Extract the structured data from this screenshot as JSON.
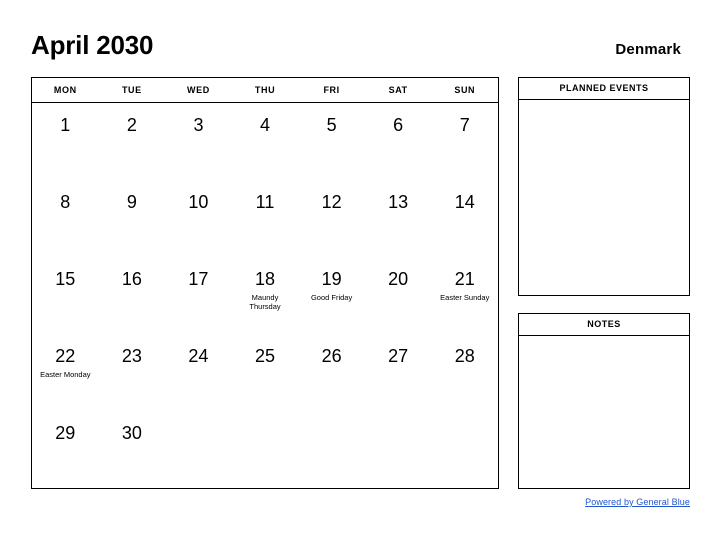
{
  "header": {
    "title": "April 2030",
    "region": "Denmark"
  },
  "calendar": {
    "weekdays": [
      "MON",
      "TUE",
      "WED",
      "THU",
      "FRI",
      "SAT",
      "SUN"
    ],
    "weeks": [
      [
        {
          "day": "1",
          "event": ""
        },
        {
          "day": "2",
          "event": ""
        },
        {
          "day": "3",
          "event": ""
        },
        {
          "day": "4",
          "event": ""
        },
        {
          "day": "5",
          "event": ""
        },
        {
          "day": "6",
          "event": ""
        },
        {
          "day": "7",
          "event": ""
        }
      ],
      [
        {
          "day": "8",
          "event": ""
        },
        {
          "day": "9",
          "event": ""
        },
        {
          "day": "10",
          "event": ""
        },
        {
          "day": "11",
          "event": ""
        },
        {
          "day": "12",
          "event": ""
        },
        {
          "day": "13",
          "event": ""
        },
        {
          "day": "14",
          "event": ""
        }
      ],
      [
        {
          "day": "15",
          "event": ""
        },
        {
          "day": "16",
          "event": ""
        },
        {
          "day": "17",
          "event": ""
        },
        {
          "day": "18",
          "event": "Maundy\nThursday"
        },
        {
          "day": "19",
          "event": "Good Friday"
        },
        {
          "day": "20",
          "event": ""
        },
        {
          "day": "21",
          "event": "Easter Sunday"
        }
      ],
      [
        {
          "day": "22",
          "event": "Easter Monday"
        },
        {
          "day": "23",
          "event": ""
        },
        {
          "day": "24",
          "event": ""
        },
        {
          "day": "25",
          "event": ""
        },
        {
          "day": "26",
          "event": ""
        },
        {
          "day": "27",
          "event": ""
        },
        {
          "day": "28",
          "event": ""
        }
      ],
      [
        {
          "day": "29",
          "event": ""
        },
        {
          "day": "30",
          "event": ""
        },
        {
          "day": "",
          "event": ""
        },
        {
          "day": "",
          "event": ""
        },
        {
          "day": "",
          "event": ""
        },
        {
          "day": "",
          "event": ""
        },
        {
          "day": "",
          "event": ""
        }
      ]
    ]
  },
  "panels": {
    "planned_events_title": "PLANNED EVENTS",
    "planned_events_body": "",
    "notes_title": "NOTES",
    "notes_body": ""
  },
  "footer": {
    "link_text": "Powered by General Blue",
    "link_color": "#2255cc"
  }
}
